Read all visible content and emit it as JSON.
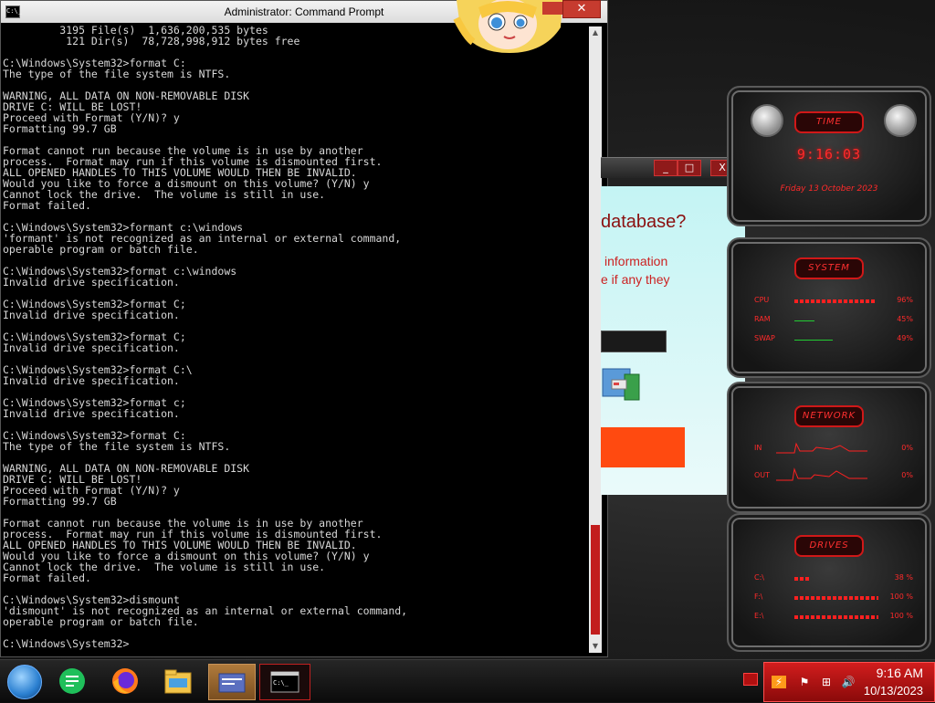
{
  "cmd": {
    "title": "Administrator: Command Prompt",
    "icon_text": "C:\\_",
    "close_glyph": "✕",
    "lines": [
      "         3195 File(s)  1,636,200,535 bytes",
      "          121 Dir(s)  78,728,998,912 bytes free",
      "",
      "C:\\Windows\\System32>format C:",
      "The type of the file system is NTFS.",
      "",
      "WARNING, ALL DATA ON NON-REMOVABLE DISK",
      "DRIVE C: WILL BE LOST!",
      "Proceed with Format (Y/N)? y",
      "Formatting 99.7 GB",
      "",
      "Format cannot run because the volume is in use by another",
      "process.  Format may run if this volume is dismounted first.",
      "ALL OPENED HANDLES TO THIS VOLUME WOULD THEN BE INVALID.",
      "Would you like to force a dismount on this volume? (Y/N) y",
      "Cannot lock the drive.  The volume is still in use.",
      "Format failed.",
      "",
      "C:\\Windows\\System32>formant c:\\windows",
      "'formant' is not recognized as an internal or external command,",
      "operable program or batch file.",
      "",
      "C:\\Windows\\System32>format c:\\windows",
      "Invalid drive specification.",
      "",
      "C:\\Windows\\System32>format C;",
      "Invalid drive specification.",
      "",
      "C:\\Windows\\System32>format C;",
      "Invalid drive specification.",
      "",
      "C:\\Windows\\System32>format C:\\",
      "Invalid drive specification.",
      "",
      "C:\\Windows\\System32>format c;",
      "Invalid drive specification.",
      "",
      "C:\\Windows\\System32>format C:",
      "The type of the file system is NTFS.",
      "",
      "WARNING, ALL DATA ON NON-REMOVABLE DISK",
      "DRIVE C: WILL BE LOST!",
      "Proceed with Format (Y/N)? y",
      "Formatting 99.7 GB",
      "",
      "Format cannot run because the volume is in use by another",
      "process.  Format may run if this volume is dismounted first.",
      "ALL OPENED HANDLES TO THIS VOLUME WOULD THEN BE INVALID.",
      "Would you like to force a dismount on this volume? (Y/N) y",
      "Cannot lock the drive.  The volume is still in use.",
      "Format failed.",
      "",
      "C:\\Windows\\System32>dismount",
      "'dismount' is not recognized as an internal or external command,",
      "operable program or batch file.",
      "",
      "C:\\Windows\\System32>"
    ]
  },
  "dialog": {
    "heading": "database?",
    "text1": "information",
    "text2": "e if any they",
    "min_glyph": "_",
    "max_glyph": "□",
    "close_glyph": "X"
  },
  "widgets": {
    "time": {
      "badge": "TIME",
      "clock": "9:16:03",
      "date": "Friday 13 October 2023"
    },
    "system": {
      "badge": "SYSTEM",
      "rows": [
        {
          "label": "CPU",
          "value": "96%",
          "level": 0.96
        },
        {
          "label": "RAM",
          "value": "45%",
          "level": 0.45
        },
        {
          "label": "SWAP",
          "value": "49%",
          "level": 0.49
        }
      ]
    },
    "network": {
      "badge": "NETWORK",
      "rows": [
        {
          "label": "IN",
          "value": "0%"
        },
        {
          "label": "OUT",
          "value": "0%"
        }
      ]
    },
    "drives": {
      "badge": "DRIVES",
      "rows": [
        {
          "label": "C:\\",
          "value": "38 %",
          "level": 0.38
        },
        {
          "label": "F:\\",
          "value": "100 %",
          "level": 1.0
        },
        {
          "label": "E:\\",
          "value": "100 %",
          "level": 1.0
        }
      ]
    }
  },
  "taskbar": {
    "clock_time": "9:16 AM",
    "clock_date": "10/13/2023",
    "cmd_icon_text": "C:\\_"
  },
  "colors": {
    "accent_red": "#ff2a2a",
    "tray_red": "#d21d1d",
    "console_text": "#d8d8d8"
  }
}
